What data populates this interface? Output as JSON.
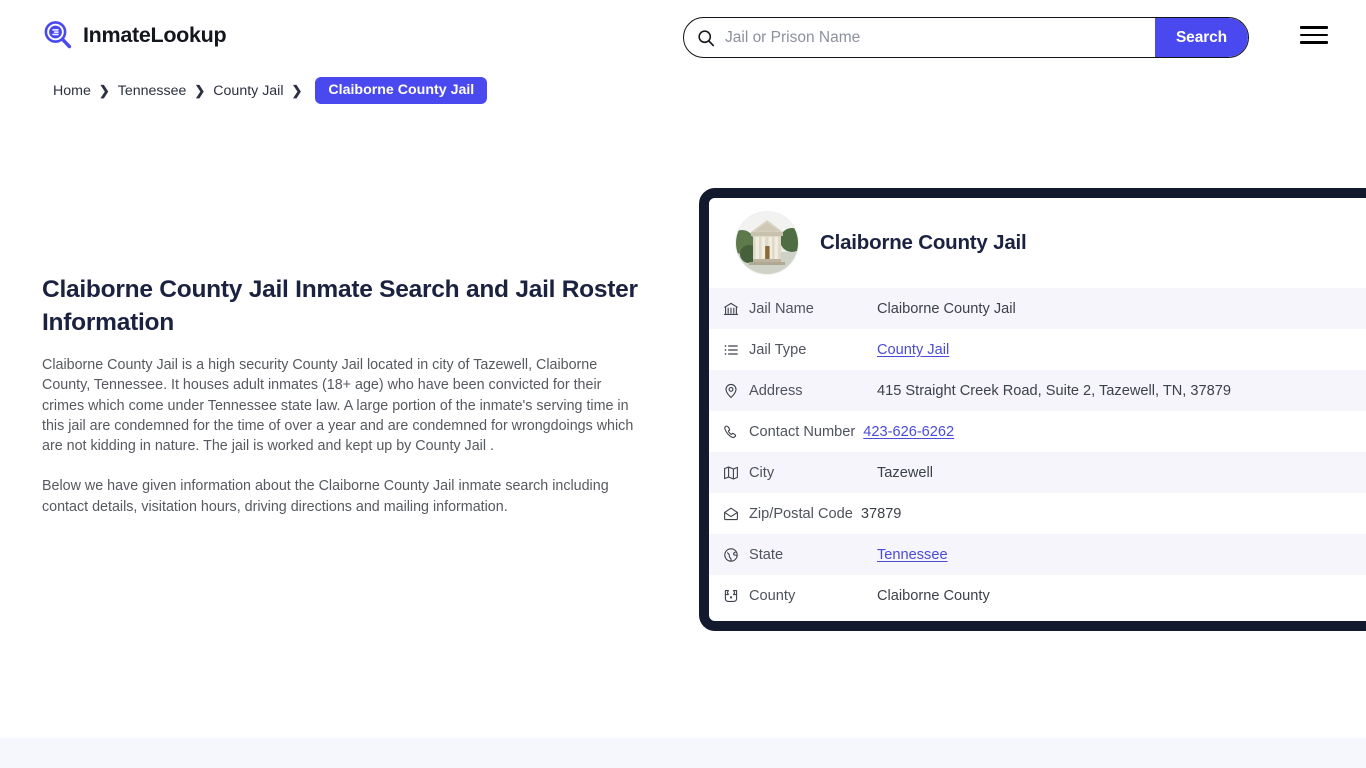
{
  "header": {
    "brand_name": "InmateLookup",
    "logo_icon": "magnifier-logo-icon",
    "menu_icon": "hamburger-menu-icon",
    "accent_color": "#4a49ef",
    "search": {
      "icon": "search-icon",
      "placeholder": "Jail or Prison Name",
      "value": "",
      "button_label": "Search"
    }
  },
  "breadcrumb": {
    "items": [
      {
        "label": "Home",
        "current": false
      },
      {
        "label": "Tennessee",
        "current": false
      },
      {
        "label": "County Jail",
        "current": false
      }
    ],
    "separator": "❯",
    "current": "Claiborne County Jail"
  },
  "main": {
    "title": "Claiborne County Jail Inmate Search and Jail Roster Information",
    "paragraph_1": "Claiborne County Jail is a high security County Jail located in city of Tazewell, Claiborne County, Tennessee. It houses adult inmates (18+ age) who have been convicted for their crimes which come under Tennessee state law. A large portion of the inmate's serving time in this jail are condemned for the time of over a year and are condemned for wrongdoings which are not kidding in nature. The jail is worked and kept up by County Jail .",
    "paragraph_2": "Below we have given information about the Claiborne County Jail inmate search including contact details, visitation hours, driving directions and mailing information."
  },
  "card": {
    "border_color": "#141a2e",
    "avatar_icon": "courthouse-photo",
    "title": "Claiborne County Jail",
    "rows": [
      {
        "icon": "bank-icon",
        "label": "Jail Name",
        "value": "Claiborne County Jail",
        "link": false,
        "wide_label": true
      },
      {
        "icon": "list-icon",
        "label": "Jail Type",
        "value": "County Jail",
        "link": true,
        "wide_label": true
      },
      {
        "icon": "map-pin-icon",
        "label": "Address",
        "value": "415 Straight Creek Road, Suite 2, Tazewell, TN, 37879",
        "link": false,
        "wide_label": true
      },
      {
        "icon": "phone-icon",
        "label": "Contact Number",
        "value": "423-626-6262",
        "link": true,
        "wide_label": false
      },
      {
        "icon": "map-icon",
        "label": "City",
        "value": "Tazewell",
        "link": false,
        "wide_label": true
      },
      {
        "icon": "envelope-open-icon",
        "label": "Zip/Postal Code",
        "value": "37879",
        "link": false,
        "wide_label": false
      },
      {
        "icon": "globe-icon",
        "label": "State",
        "value": "Tennessee",
        "link": true,
        "wide_label": true
      },
      {
        "icon": "badge-icon",
        "label": "County",
        "value": "Claiborne County",
        "link": false,
        "wide_label": true
      }
    ]
  }
}
